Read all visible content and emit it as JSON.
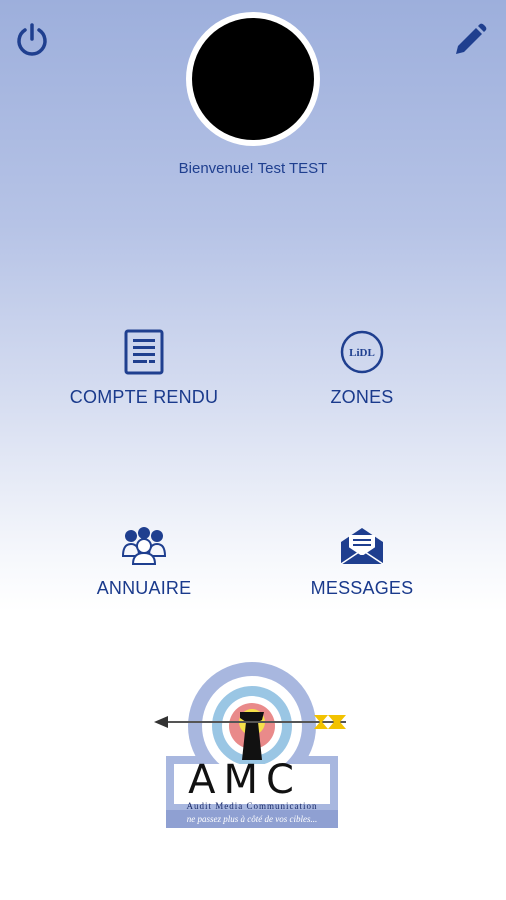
{
  "header": {
    "power_icon": "power-icon",
    "edit_icon": "pencil-icon",
    "welcome": "Bienvenue! Test TEST"
  },
  "menu": [
    {
      "label": "COMPTE RENDU",
      "icon": "document-icon"
    },
    {
      "label": "ZONES",
      "icon": "lidl-icon"
    },
    {
      "label": "ANNUAIRE",
      "icon": "people-icon"
    },
    {
      "label": "MESSAGES",
      "icon": "envelope-icon"
    }
  ],
  "lidl_logo_text": "LiDL",
  "logo": {
    "title": "AMC",
    "subtitle": "Audit Media Communication",
    "tagline": "ne passez plus à côté de vos cibles..."
  },
  "colors": {
    "accent": "#1f3f8f",
    "gradient_top": "#9dafdc",
    "background": "#ffffff"
  }
}
